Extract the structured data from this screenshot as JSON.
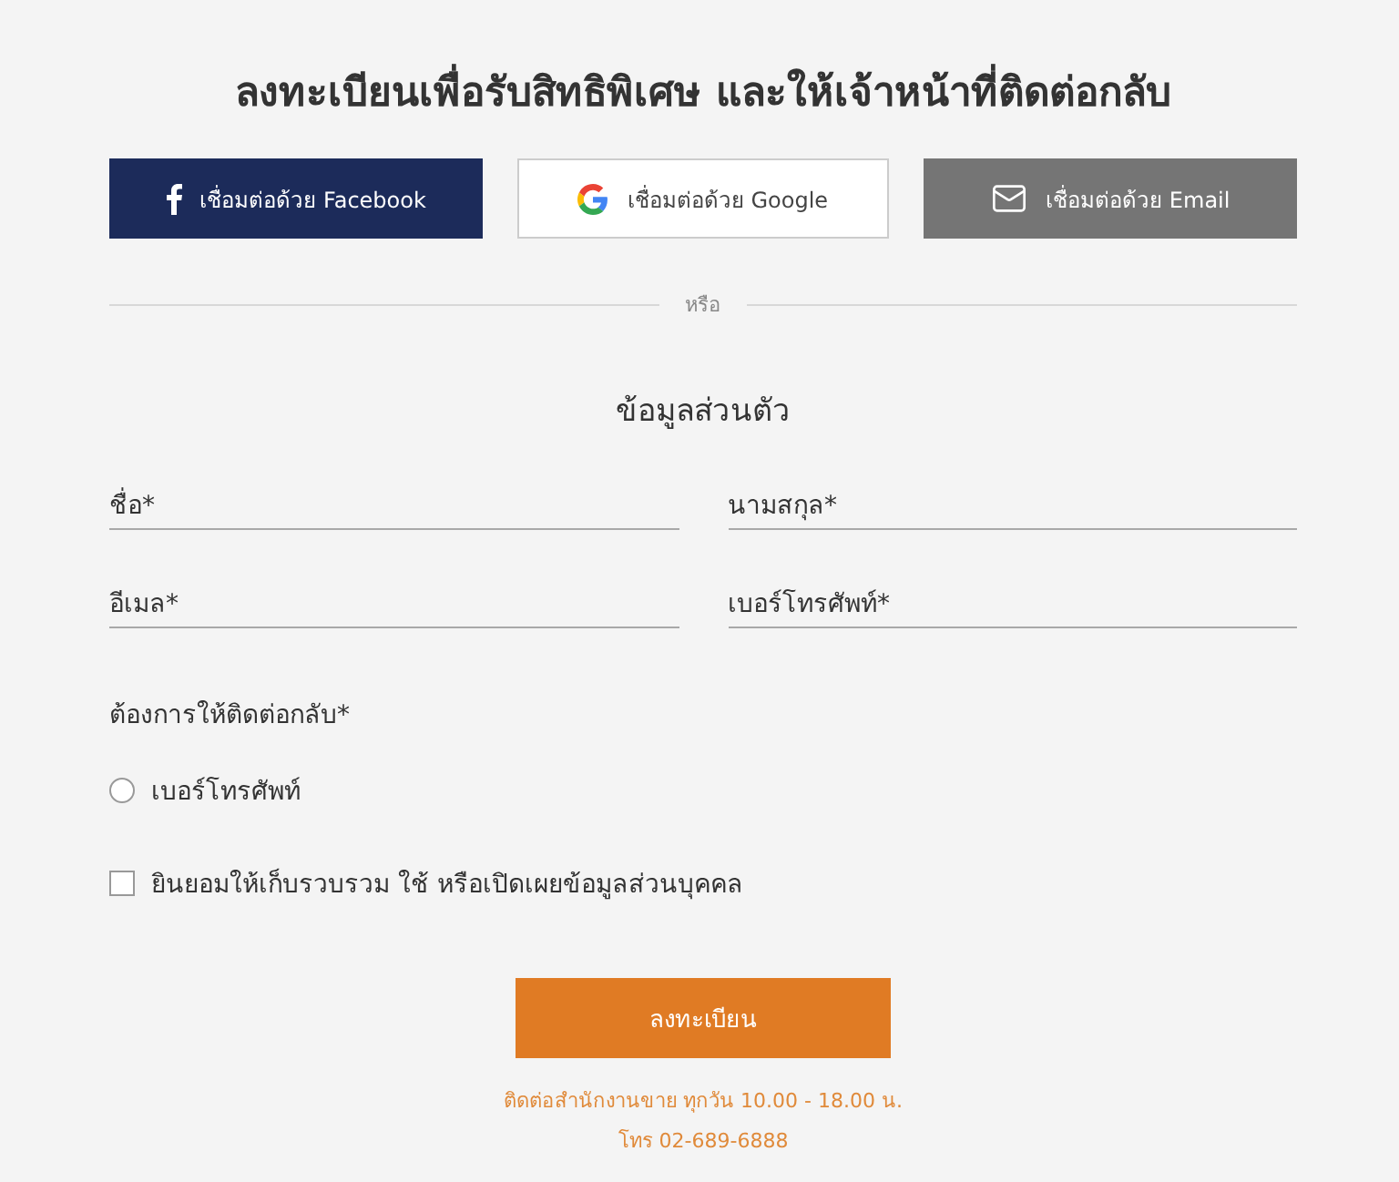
{
  "heading": "ลงทะเบียนเพื่อรับสิทธิพิเศษ และให้เจ้าหน้าที่ติดต่อกลับ",
  "social_buttons": [
    {
      "kind": "facebook",
      "label": "เชื่อมต่อด้วย Facebook"
    },
    {
      "kind": "google",
      "label": "เชื่อมต่อด้วย Google"
    },
    {
      "kind": "email",
      "label": "เชื่อมต่อด้วย Email"
    }
  ],
  "divider_text": "หรือ",
  "section_title": "ข้อมูลส่วนตัว",
  "fields": [
    {
      "placeholder": "ชื่อ*"
    },
    {
      "placeholder": "นามสกุล*"
    },
    {
      "placeholder": "อีเมล*"
    },
    {
      "placeholder": "เบอร์โทรศัพท์*"
    }
  ],
  "callback": {
    "label": "ต้องการให้ติดต่อกลับ*",
    "options": [
      {
        "label": "เบอร์โทรศัพท์",
        "selected": false
      }
    ]
  },
  "consent": {
    "label": "ยินยอมให้เก็บรวบรวม ใช้ หรือเปิดเผยข้อมูลส่วนบุคคล",
    "checked": false
  },
  "submit_button": "ลงทะเบียน",
  "footer_lines": [
    "ติดต่อสำนักงานขาย ทุกวัน 10.00 - 18.00 น.",
    "โทร 02-689-6888"
  ]
}
